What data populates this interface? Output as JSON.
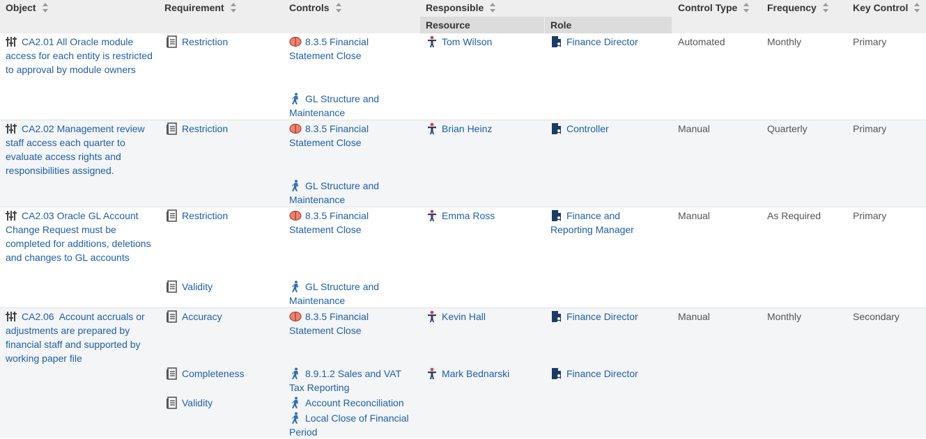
{
  "headers": {
    "object": "Object",
    "requirement": "Requirement",
    "controls": "Controls",
    "responsible": "Responsible",
    "resource": "Resource",
    "role": "Role",
    "control_type": "Control Type",
    "frequency": "Frequency",
    "key_control": "Key Control"
  },
  "rows": [
    {
      "object": "CA2.01 All Oracle module access for each entity is restricted to approval by module owners",
      "requirements": [
        "Restriction"
      ],
      "controls": [
        "8.3.5 Financial Statement Close",
        "GL Structure and Maintenance"
      ],
      "resources": [
        "Tom Wilson"
      ],
      "roles": [
        "Finance Director"
      ],
      "control_type": "Automated",
      "frequency": "Monthly",
      "key_control": "Primary"
    },
    {
      "object": "CA2.02 Management review staff access each quarter to evaluate access rights and responsibilities assigned.",
      "requirements": [
        "Restriction"
      ],
      "controls": [
        "8.3.5 Financial Statement Close",
        "GL Structure and Maintenance"
      ],
      "resources": [
        "Brian Heinz"
      ],
      "roles": [
        "Controller"
      ],
      "control_type": "Manual",
      "frequency": "Quarterly",
      "key_control": "Primary"
    },
    {
      "object": "CA2.03 Oracle GL Account Change Request must be completed for additions, deletions and changes to GL accounts",
      "requirements": [
        "Restriction",
        "Validity"
      ],
      "controls": [
        "8.3.5 Financial Statement Close",
        "GL Structure and Maintenance"
      ],
      "resources": [
        "Emma Ross"
      ],
      "roles": [
        "Finance and Reporting Manager"
      ],
      "control_type": "Manual",
      "frequency": "As Required",
      "key_control": "Primary"
    },
    {
      "object": "CA2.06  Account accruals or adjustments are prepared by financial staff and supported by working paper file",
      "requirements": [
        "Accuracy",
        "Completeness",
        "Validity"
      ],
      "controls": [
        "8.3.5 Financial Statement Close",
        "8.9.1.2 Sales and VAT Tax Reporting",
        "Account Reconciliation",
        "Local Close of Financial Period"
      ],
      "resources": [
        "Kevin Hall",
        "Mark Bednarski"
      ],
      "roles": [
        "Finance Director",
        "Finance Director"
      ],
      "control_type": "Manual",
      "frequency": "Monthly",
      "key_control": "Secondary"
    }
  ],
  "icons": {
    "object": "control-objective-icon",
    "requirement": "requirement-document-icon",
    "control_risk": "risk-target-icon",
    "control_process": "walking-person-process-icon",
    "resource": "person-icon",
    "role": "role-document-icon",
    "sort": "sort-arrows-icon"
  },
  "colors": {
    "link": "#1f5fa8",
    "header_bg": "#eeeeee",
    "subheader_bg": "#dcdcdc",
    "alt_row": "#f3f5f7",
    "risk_icon": "#e05a4a",
    "person_icon_head": "#e03030"
  }
}
